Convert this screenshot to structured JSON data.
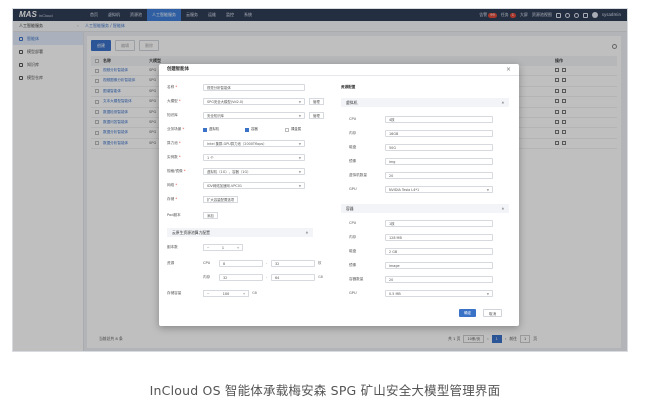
{
  "app": {
    "logo": "MAS",
    "logo_sub": "InCloud"
  },
  "nav": [
    "首页",
    "虚拟机",
    "资源池",
    "人工智能服务",
    "云服务",
    "运维",
    "监控",
    "系统"
  ],
  "nav_active_index": 3,
  "topright": {
    "alerts": "告警",
    "alerts_count": "99",
    "tasks": "任务",
    "tasks_count": "1",
    "big_screen": "大屏",
    "view": "资源池视图",
    "user": "sysadmin"
  },
  "breadcrumb": {
    "section": "人工智能服务",
    "path": "人工智能服务 / 智能体"
  },
  "sidebar": {
    "items": [
      "智能体",
      "模型部署",
      "知识库",
      "模型仓库"
    ],
    "active_index": 0
  },
  "toolbar": {
    "create": "创建",
    "edit": "编辑",
    "delete": "删除"
  },
  "table": {
    "headers": {
      "name": "名称",
      "model": "大模型",
      "ops": "操作"
    },
    "rows": [
      {
        "name": "视频分析智能体",
        "model": "SPG"
      },
      {
        "name": "视频图像分析智能体",
        "model": "SPG"
      },
      {
        "name": "图谱智能体",
        "model": "SPG"
      },
      {
        "name": "文本大模型智能体",
        "model": "SPG"
      },
      {
        "name": "数据检测智能体",
        "model": "SPG"
      },
      {
        "name": "数据问答智能体",
        "model": "SPG"
      },
      {
        "name": "数据分析智能体",
        "model": "SPG"
      },
      {
        "name": "数据分析智能体",
        "model": "SPG"
      }
    ]
  },
  "footer": {
    "total": "当前总共 8 条",
    "pages_label": "共 1 页",
    "per_page": "10条/页",
    "current_page": "1",
    "goto": "前往",
    "goto_value": "1",
    "page_suffix": "页"
  },
  "modal": {
    "title": "创建智能体",
    "fields": {
      "name_label": "名称",
      "name_value": "视觉分析智能体",
      "model_label": "大模型",
      "model_value": "SPG安全大模型(Vd2.0)",
      "model_btn": "管理",
      "kb_label": "知识库",
      "kb_value": "安全知识库",
      "kb_btn": "管理",
      "arch_label": "业务场景",
      "arch_opts": [
        "虚拟机",
        "容器",
        "裸金属"
      ],
      "compute_label": "算力池",
      "compute_value": "Intel 集群-GPU算力池（2000Tflops）",
      "count_label": "实例数",
      "count_value": "1 个",
      "flavor_label": "规格/镜像",
      "flavor_value": "虚拟机（1G）、容器（1G）",
      "net_label": "网络",
      "net_value": "IDV网络加速网-VPC01",
      "storage_label": "存储",
      "storage_btn": "扩大容量配置选项",
      "pool_label": "Pod副本",
      "pool_btn": "添加"
    },
    "resource": {
      "title": "云原生资源池算力配置",
      "replicas_label": "副本数",
      "replicas_value": "1",
      "resource_label": "资源",
      "cpu_label": "CPU",
      "cpu_min": "8",
      "cpu_max": "32",
      "cpu_unit": "核",
      "mem_label": "内存",
      "mem_min": "32",
      "mem_max": "64",
      "mem_unit": "GB",
      "disk_label": "存储容量",
      "disk_value": "100",
      "disk_unit": "GB"
    },
    "right_title": "资源配置",
    "vm": {
      "title": "虚拟机",
      "rows": [
        {
          "label": "CPU",
          "value": "4核"
        },
        {
          "label": "内存",
          "value": "16GB"
        },
        {
          "label": "磁盘",
          "value": "50G"
        },
        {
          "label": "镜像",
          "value": "img"
        },
        {
          "label": "虚拟机数量",
          "value": "20"
        },
        {
          "label": "GPU",
          "value": "NVIDIA Tesla L4*1"
        }
      ]
    },
    "ct": {
      "title": "容器",
      "rows": [
        {
          "label": "CPU",
          "value": "1核"
        },
        {
          "label": "内存",
          "value": "128 MB"
        },
        {
          "label": "磁盘",
          "value": "2 GB"
        },
        {
          "label": "镜像",
          "value": "image"
        },
        {
          "label": "容器数量",
          "value": "20"
        },
        {
          "label": "GPU",
          "value": "0.5 MB"
        }
      ]
    },
    "confirm": "确定",
    "cancel": "取消"
  },
  "caption": "InCloud OS  智能体承载梅安森 SPG 矿山安全大模型管理界面",
  "colors": {
    "topbar": "#2f3e57",
    "accent": "#3a72c8",
    "alert": "#e24b3b"
  }
}
